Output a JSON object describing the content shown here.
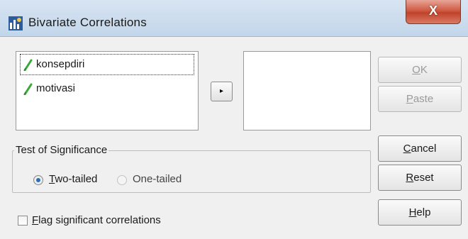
{
  "window": {
    "title": "Bivariate Correlations",
    "close_glyph": "X"
  },
  "variables": {
    "source": [
      {
        "name": "konsepdiri",
        "icon": "scale-pencil-icon",
        "selected": true
      },
      {
        "name": "motivasi",
        "icon": "scale-pencil-icon",
        "selected": false
      }
    ],
    "target": []
  },
  "move_button": {
    "glyph": "▸"
  },
  "buttons": {
    "ok": {
      "mnemonic": "O",
      "rest": "K",
      "enabled": false
    },
    "paste": {
      "mnemonic": "P",
      "rest": "aste",
      "enabled": false
    },
    "cancel": {
      "mnemonic": "C",
      "rest": "ancel",
      "enabled": true
    },
    "reset": {
      "mnemonic": "R",
      "rest": "eset",
      "enabled": true
    },
    "help": {
      "mnemonic": "H",
      "rest": "elp",
      "enabled": true
    }
  },
  "significance": {
    "legend": "Test of Significance",
    "two_tailed": {
      "mnemonic": "T",
      "rest": "wo-tailed",
      "checked": true
    },
    "one_tailed": {
      "label": "One-tailed",
      "checked": false
    }
  },
  "flag": {
    "mnemonic": "F",
    "rest": "lag significant correlations",
    "checked": false
  },
  "colors": {
    "accent": "#2a6fb5",
    "pencil": "#3aa83a",
    "close": "#c0432b"
  }
}
